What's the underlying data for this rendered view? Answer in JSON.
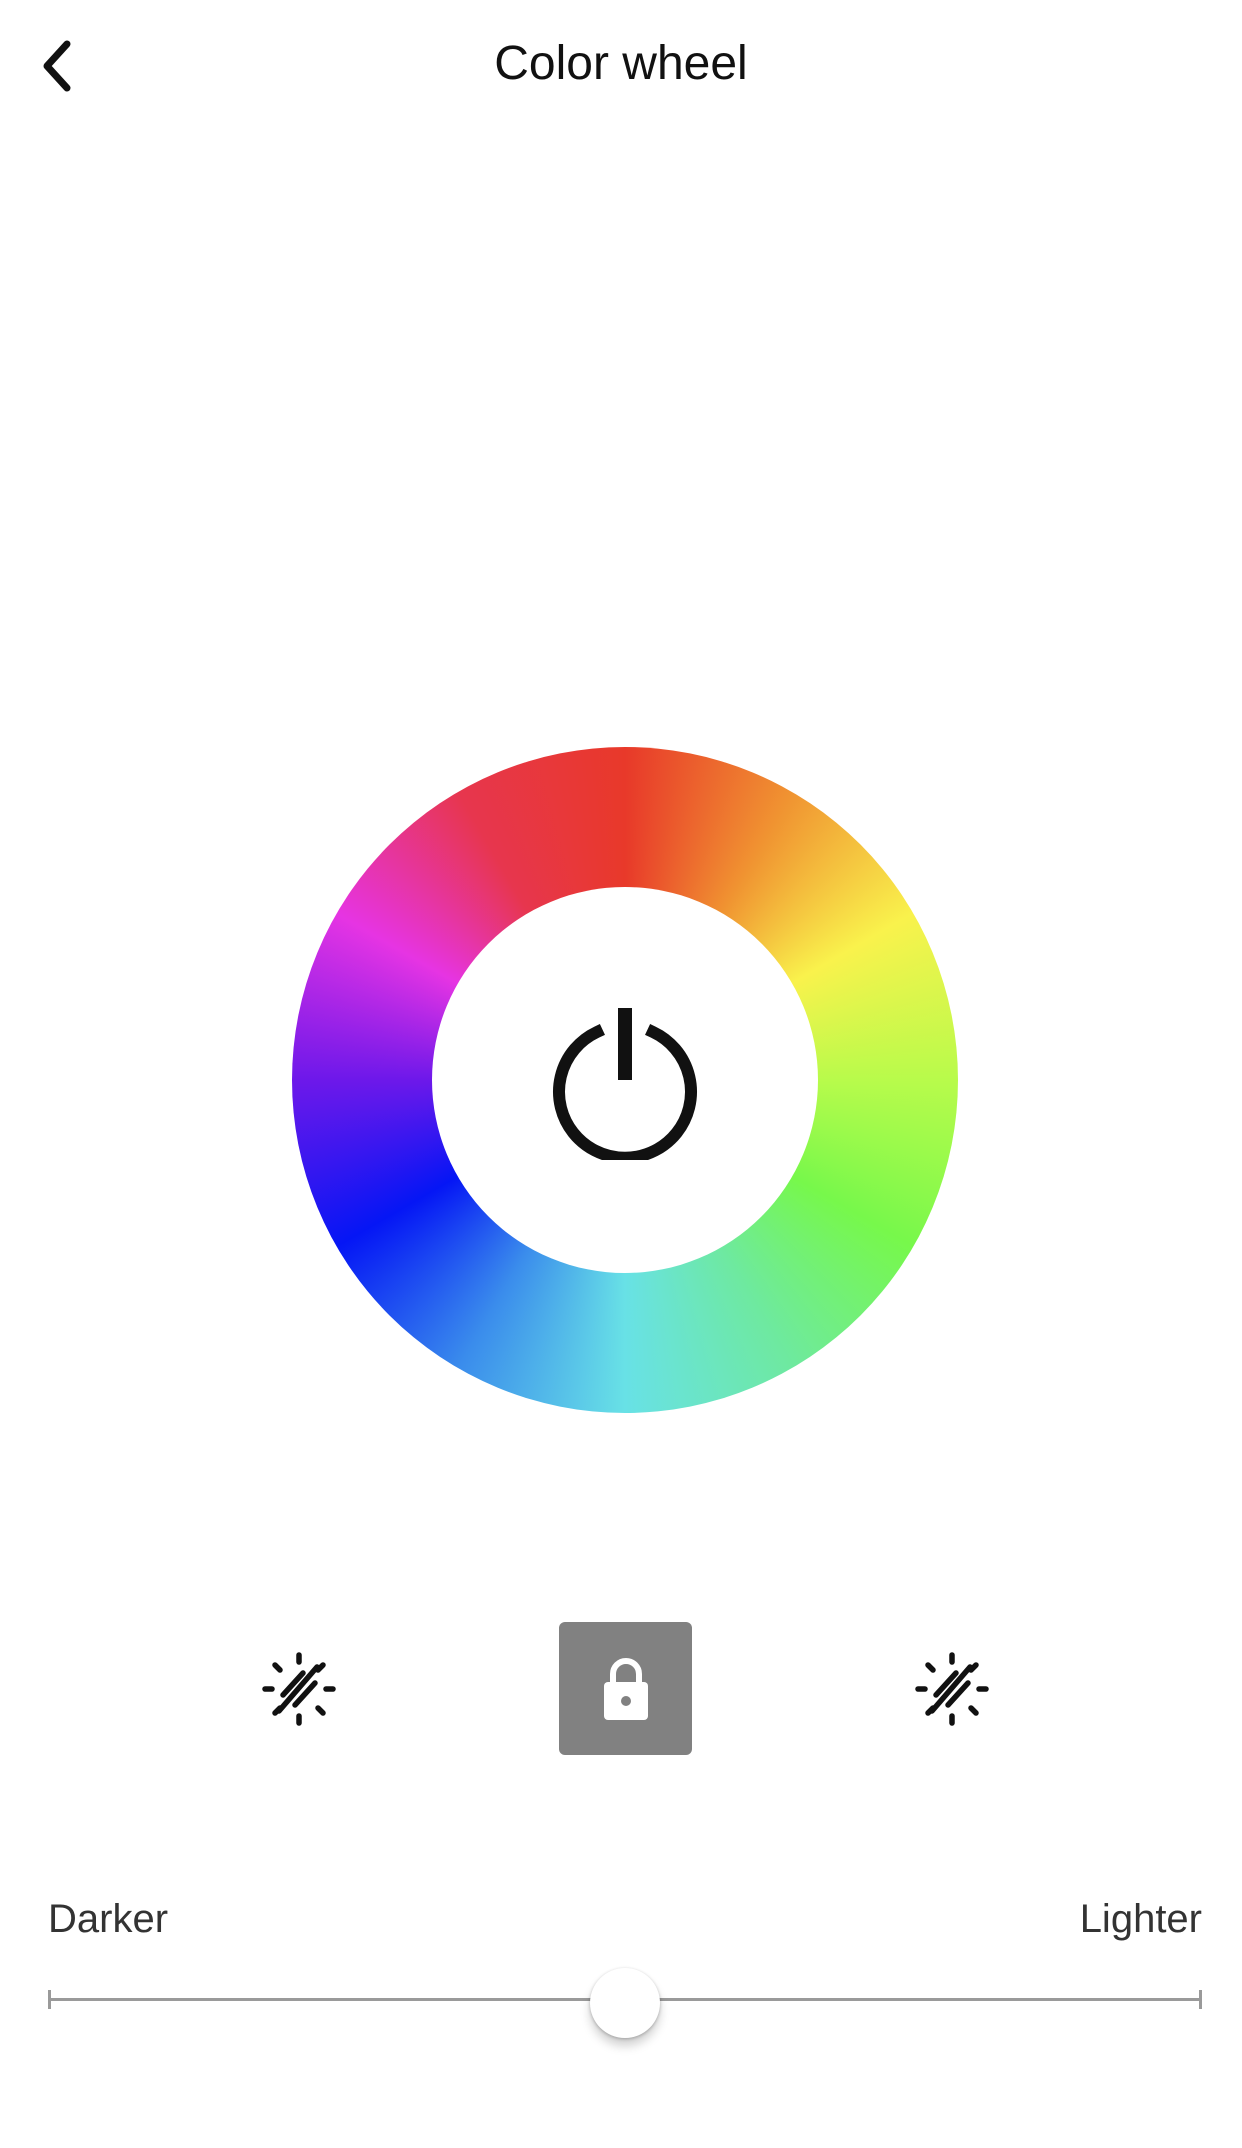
{
  "header": {
    "title": "Color wheel",
    "back_icon": "chevron-left-icon"
  },
  "wheel": {
    "center_icon": "power-icon",
    "hue_stops": [
      "#e8392a",
      "#f09331",
      "#f9f24c",
      "#b8fb4b",
      "#77f84b",
      "#6ee9a0",
      "#68e1e6",
      "#3a8cec",
      "#0516f5",
      "#6d18ea",
      "#e634e3",
      "#e7364e"
    ]
  },
  "controls": {
    "left_icon": "brightness-off-icon",
    "center_icon": "lock-icon",
    "right_icon": "brightness-off-icon",
    "lock_bg_color": "#818181"
  },
  "brightness": {
    "min_label": "Darker",
    "max_label": "Lighter",
    "value_fraction": 0.5
  }
}
